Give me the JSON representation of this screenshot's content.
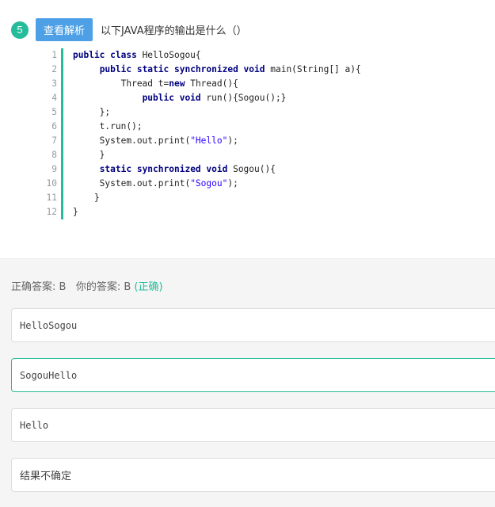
{
  "question": {
    "number": "5",
    "analysis_button": "查看解析",
    "title": "以下JAVA程序的输出是什么（）"
  },
  "code": {
    "lines": [
      {
        "no": "1",
        "tokens": [
          {
            "t": "kw",
            "v": "public class "
          },
          {
            "t": "n",
            "v": "HelloSogou{"
          }
        ]
      },
      {
        "no": "2",
        "tokens": [
          {
            "t": "n",
            "v": "     "
          },
          {
            "t": "kw",
            "v": "public static synchronized void "
          },
          {
            "t": "n",
            "v": "main(String[] a){"
          }
        ]
      },
      {
        "no": "3",
        "tokens": [
          {
            "t": "n",
            "v": "         Thread t="
          },
          {
            "t": "kw",
            "v": "new "
          },
          {
            "t": "n",
            "v": "Thread(){"
          }
        ]
      },
      {
        "no": "4",
        "tokens": [
          {
            "t": "n",
            "v": "             "
          },
          {
            "t": "kw",
            "v": "public void "
          },
          {
            "t": "n",
            "v": "run(){Sogou();}"
          }
        ]
      },
      {
        "no": "5",
        "tokens": [
          {
            "t": "n",
            "v": "     };"
          }
        ]
      },
      {
        "no": "6",
        "tokens": [
          {
            "t": "n",
            "v": "     t.run();"
          }
        ]
      },
      {
        "no": "7",
        "tokens": [
          {
            "t": "n",
            "v": "     System.out.print("
          },
          {
            "t": "str",
            "v": "\"Hello\""
          },
          {
            "t": "n",
            "v": ");"
          }
        ]
      },
      {
        "no": "8",
        "tokens": [
          {
            "t": "n",
            "v": "     }"
          }
        ]
      },
      {
        "no": "9",
        "tokens": [
          {
            "t": "n",
            "v": "     "
          },
          {
            "t": "kw",
            "v": "static synchronized void "
          },
          {
            "t": "n",
            "v": "Sogou(){"
          }
        ]
      },
      {
        "no": "10",
        "tokens": [
          {
            "t": "n",
            "v": "     System.out.print("
          },
          {
            "t": "str",
            "v": "\"Sogou\""
          },
          {
            "t": "n",
            "v": ");"
          }
        ]
      },
      {
        "no": "11",
        "tokens": [
          {
            "t": "n",
            "v": "    }"
          }
        ]
      },
      {
        "no": "12",
        "tokens": [
          {
            "t": "n",
            "v": "}"
          }
        ]
      }
    ]
  },
  "answer": {
    "correct_label": "正确答案: B",
    "yours_label": "你的答案: B",
    "result": "(正确)"
  },
  "options": [
    {
      "text": "HelloSogou",
      "selected": false,
      "cn": false
    },
    {
      "text": "SogouHello",
      "selected": true,
      "cn": false
    },
    {
      "text": "Hello",
      "selected": false,
      "cn": false
    },
    {
      "text": "结果不确定",
      "selected": false,
      "cn": true
    }
  ],
  "colors": {
    "accent": "#25bb9b",
    "button": "#4ea0e6"
  }
}
